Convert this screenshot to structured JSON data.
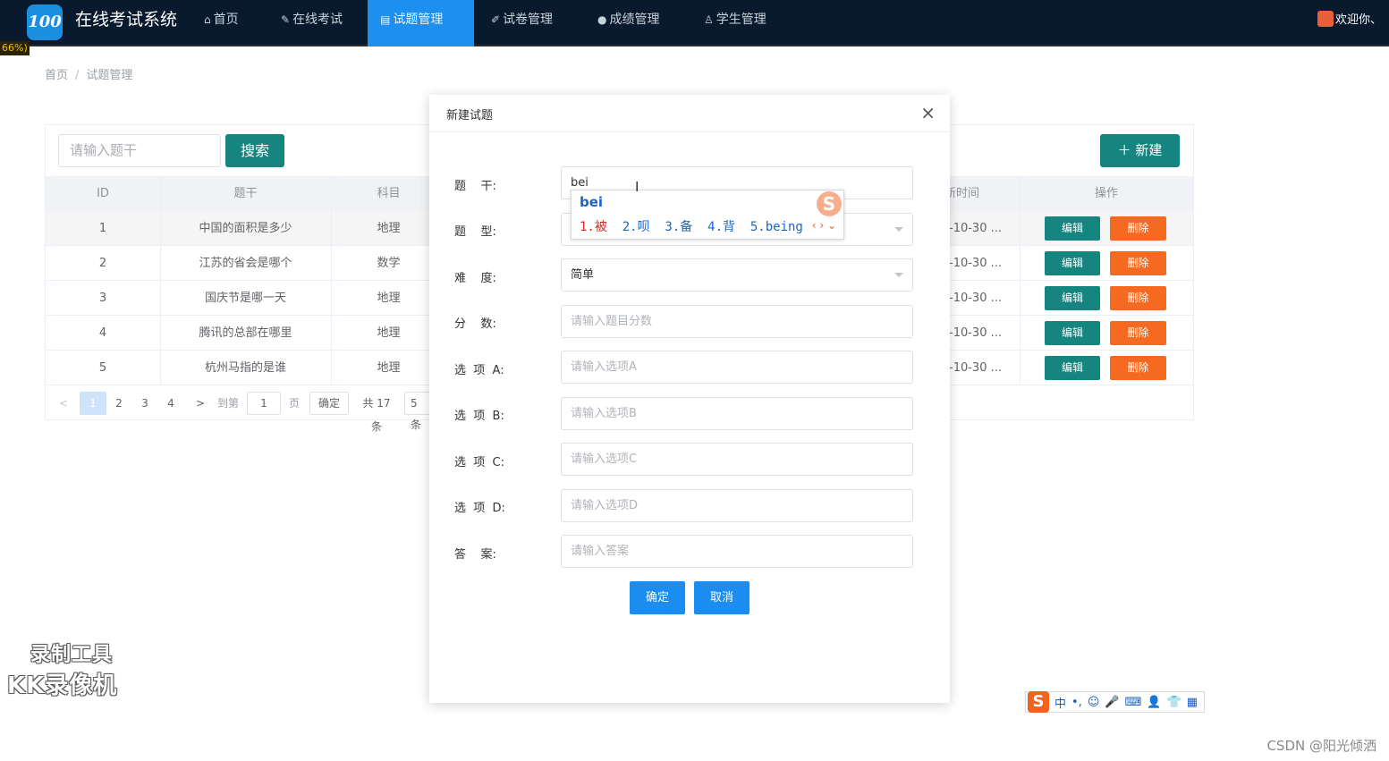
{
  "app": {
    "logo_text": "100",
    "title": "在线考试系统",
    "zoom_badge": "66%)"
  },
  "nav": {
    "items": [
      {
        "icon": "⌂",
        "label": "首页"
      },
      {
        "icon": "✎",
        "label": "在线考试"
      },
      {
        "icon": "▤",
        "label": "试题管理"
      },
      {
        "icon": "✐",
        "label": "试卷管理"
      },
      {
        "icon": "●",
        "label": "成绩管理"
      },
      {
        "icon": "♙",
        "label": "学生管理"
      }
    ],
    "active": "试题管理",
    "welcome": "欢迎你、"
  },
  "breadcrumb": {
    "home": "首页",
    "sep": "/",
    "current": "试题管理"
  },
  "toolbar": {
    "search_placeholder": "请输入题干",
    "search_label": "搜索",
    "new_label": "＋ 新建"
  },
  "table": {
    "headers": {
      "id": "ID",
      "stem": "题干",
      "subject": "科目",
      "time": "新时间",
      "actions": "操作"
    },
    "rows": [
      {
        "id": "1",
        "stem": "中国的面积是多少",
        "subject": "地理",
        "time": "-10-30 ..."
      },
      {
        "id": "2",
        "stem": "江苏的省会是哪个",
        "subject": "数学",
        "time": "-10-30 ..."
      },
      {
        "id": "3",
        "stem": "国庆节是哪一天",
        "subject": "地理",
        "time": "-10-30 ..."
      },
      {
        "id": "4",
        "stem": "腾讯的总部在哪里",
        "subject": "地理",
        "time": "-10-30 ..."
      },
      {
        "id": "5",
        "stem": "杭州马指的是谁",
        "subject": "地理",
        "time": "-10-30 ..."
      }
    ],
    "edit_label": "编辑",
    "delete_label": "删除"
  },
  "pager": {
    "prev": "<",
    "pages": [
      "1",
      "2",
      "3",
      "4"
    ],
    "next": ">",
    "goto_label": "到第",
    "goto_value": "1",
    "page_unit": "页",
    "confirm": "确定",
    "total": "共 17 条",
    "size": "5 条"
  },
  "modal": {
    "title": "新建试题",
    "close": "×",
    "fields": [
      {
        "label": "题    干:",
        "value": "bei",
        "placeholder": ""
      },
      {
        "label": "题    型:",
        "value": "",
        "placeholder": ""
      },
      {
        "label": "难    度:",
        "value": "简单",
        "placeholder": ""
      },
      {
        "label": "分    数:",
        "value": "",
        "placeholder": "请输入题目分数"
      },
      {
        "label": "选  项  A:",
        "value": "",
        "placeholder": "请输入选项A"
      },
      {
        "label": "选  项  B:",
        "value": "",
        "placeholder": "请输入选项B"
      },
      {
        "label": "选  项  C:",
        "value": "",
        "placeholder": "请输入选项C"
      },
      {
        "label": "选  项  D:",
        "value": "",
        "placeholder": "请输入选项D"
      },
      {
        "label": "答    案:",
        "value": "",
        "placeholder": "请输入答案"
      }
    ],
    "ok_label": "确定",
    "cancel_label": "取消"
  },
  "ime": {
    "composition": "bei",
    "first": "1.被",
    "candidates": "  2.呗  3.备  4.背  5.being",
    "logo": "S",
    "nav": "‹ › ⌄",
    "bar": [
      "S",
      "中",
      "•,",
      "☺",
      "🎤",
      "⌨",
      "👤",
      "👕",
      "▦"
    ]
  },
  "overlay": {
    "watermark_line1": "录制工具",
    "watermark_line2": "KK录像机",
    "csdn": "CSDN @阳光倾洒"
  }
}
